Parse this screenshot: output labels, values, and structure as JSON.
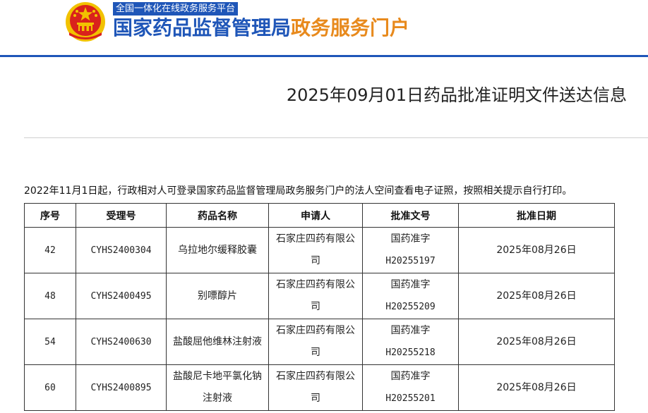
{
  "header": {
    "platform_tag": "全国一体化在线政务服务平台",
    "title_part1": "国家药品监督管理局",
    "title_part2": "政务服务门户",
    "emblem_icon": "national-emblem-icon",
    "colors": {
      "brand_blue": "#1f56b8",
      "brand_orange": "#e88a1d",
      "emblem_red": "#d9221c",
      "emblem_gold": "#f2c200"
    }
  },
  "page": {
    "title": "2025年09月01日药品批准证明文件送达信息",
    "notice": "2022年11月1日起，行政相对人可登录国家药品监督管理局政务服务门户的法人空间查看电子证照，按照相关提示自行打印。"
  },
  "table": {
    "headers": [
      "序号",
      "受理号",
      "药品名称",
      "申请人",
      "批准文号",
      "批准日期"
    ],
    "rows": [
      {
        "seq": "42",
        "accept_no": "CYHS2400304",
        "drug_name": "乌拉地尔缓释胶囊",
        "applicant": "石家庄四药有限公司",
        "approval_no_prefix": "国药准字",
        "approval_no": "H20255197",
        "approval_date": "2025年08月26日"
      },
      {
        "seq": "48",
        "accept_no": "CYHS2400495",
        "drug_name": "别嘌醇片",
        "applicant": "石家庄四药有限公司",
        "approval_no_prefix": "国药准字",
        "approval_no": "H20255209",
        "approval_date": "2025年08月26日"
      },
      {
        "seq": "54",
        "accept_no": "CYHS2400630",
        "drug_name": "盐酸屈他维林注射液",
        "applicant": "石家庄四药有限公司",
        "approval_no_prefix": "国药准字",
        "approval_no": "H20255218",
        "approval_date": "2025年08月26日"
      },
      {
        "seq": "60",
        "accept_no": "CYHS2400895",
        "drug_name": "盐酸尼卡地平氯化钠注射液",
        "applicant": "石家庄四药有限公司",
        "approval_no_prefix": "国药准字",
        "approval_no": "H20255201",
        "approval_date": "2025年08月26日"
      }
    ]
  }
}
